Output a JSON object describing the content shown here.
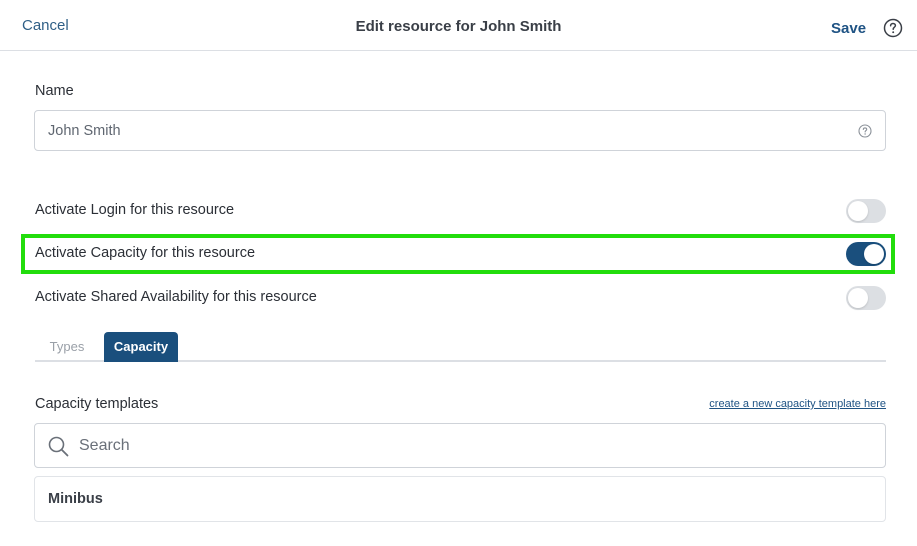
{
  "header": {
    "cancel_label": "Cancel",
    "title": "Edit resource for John Smith",
    "save_label": "Save"
  },
  "name_field": {
    "label": "Name",
    "value": "John Smith"
  },
  "toggles": [
    {
      "label": "Activate Login for this resource",
      "on": false
    },
    {
      "label": "Activate Capacity for this resource",
      "on": true
    },
    {
      "label": "Activate Shared Availability for this resource",
      "on": false
    }
  ],
  "tabs": [
    {
      "label": "Types",
      "active": false
    },
    {
      "label": "Capacity",
      "active": true
    }
  ],
  "capacity": {
    "label": "Capacity templates",
    "create_link": "create a new capacity template here",
    "search_placeholder": "Search",
    "items": [
      {
        "label": "Minibus"
      }
    ]
  },
  "colors": {
    "accent": "#1a4f7d",
    "link": "#2f5f86",
    "highlight": "#22dd0c",
    "toggle_off": "#dcdfe3"
  },
  "icons": {
    "help": "help-circle-icon",
    "search": "search-icon"
  }
}
